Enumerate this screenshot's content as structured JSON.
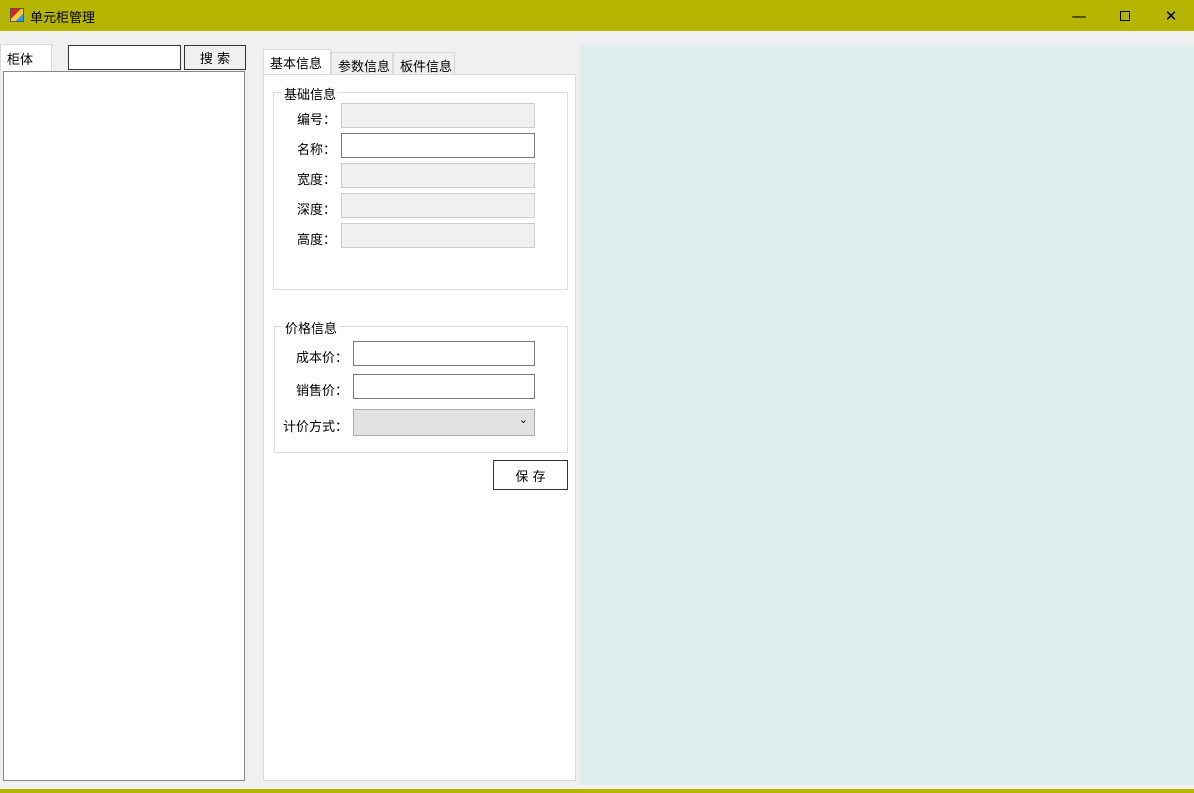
{
  "window": {
    "title": "单元柜管理",
    "minimize_icon": "minimize-icon",
    "maximize_icon": "maximize-icon",
    "close_icon": "close-icon"
  },
  "left": {
    "tab_label": "柜体",
    "search_value": "",
    "search_button": "搜 索"
  },
  "tabs": [
    {
      "label": "基本信息"
    },
    {
      "label": "参数信息"
    },
    {
      "label": "板件信息"
    }
  ],
  "basic": {
    "title": "基础信息",
    "fields": [
      {
        "label": "编号：",
        "value": ""
      },
      {
        "label": "名称：",
        "value": ""
      },
      {
        "label": "宽度：",
        "value": ""
      },
      {
        "label": "深度：",
        "value": ""
      },
      {
        "label": "高度：",
        "value": ""
      }
    ]
  },
  "price": {
    "title": "价格信息",
    "cost_label": "成本价：",
    "cost_value": "",
    "sale_label": "销售价：",
    "sale_value": "",
    "method_label": "计价方式：",
    "method_value": ""
  },
  "save_button": "保 存",
  "colors": {
    "titlebar": "#b5b500",
    "preview_bg": "#e0eeee"
  }
}
